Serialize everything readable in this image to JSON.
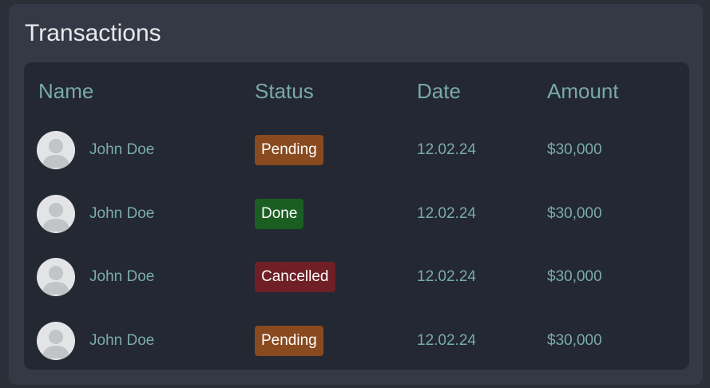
{
  "card": {
    "title": "Transactions"
  },
  "table": {
    "columns": [
      "Name",
      "Status",
      "Date",
      "Amount"
    ],
    "rows": [
      {
        "name": "John Doe",
        "status": "Pending",
        "status_kind": "pending",
        "date": "12.02.24",
        "amount": "$30,000",
        "avatar_icon": "user-avatar-icon"
      },
      {
        "name": "John Doe",
        "status": "Done",
        "status_kind": "done",
        "date": "12.02.24",
        "amount": "$30,000",
        "avatar_icon": "user-avatar-icon"
      },
      {
        "name": "John Doe",
        "status": "Cancelled",
        "status_kind": "cancelled",
        "date": "12.02.24",
        "amount": "$30,000",
        "avatar_icon": "user-avatar-icon"
      },
      {
        "name": "John Doe",
        "status": "Pending",
        "status_kind": "pending",
        "date": "12.02.24",
        "amount": "$30,000",
        "avatar_icon": "user-avatar-icon"
      }
    ]
  },
  "colors": {
    "page_background": "#2b2f38",
    "card_background": "#353945",
    "table_background": "#232833",
    "header_text": "#79a9a6",
    "pending": "#8a4a1f",
    "done": "#1b5e22",
    "cancelled": "#6f1f25"
  }
}
